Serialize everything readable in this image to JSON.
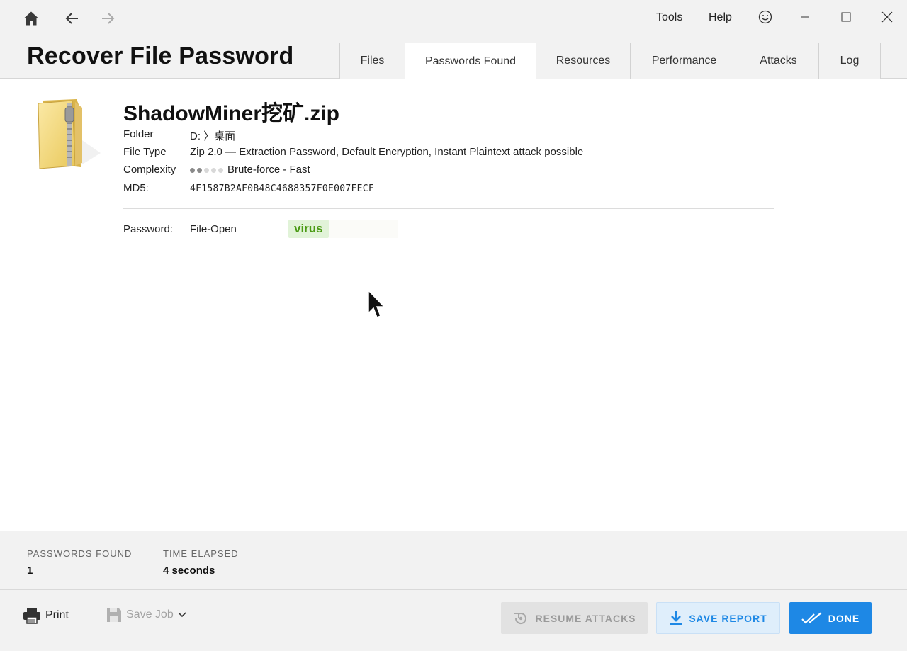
{
  "window": {
    "menu": {
      "tools": "Tools",
      "help": "Help"
    },
    "icons": {
      "home": "home-icon",
      "back": "arrow-left-icon",
      "forward": "arrow-right-icon",
      "feedback": "smiley-icon",
      "minimize": "minimize-icon",
      "maximize": "maximize-icon",
      "close": "close-icon"
    }
  },
  "app": {
    "title": "Recover File Password"
  },
  "tabs": [
    {
      "label": "Files",
      "active": false
    },
    {
      "label": "Passwords Found",
      "active": true
    },
    {
      "label": "Resources",
      "active": false
    },
    {
      "label": "Performance",
      "active": false
    },
    {
      "label": "Attacks",
      "active": false
    },
    {
      "label": "Log",
      "active": false
    }
  ],
  "file": {
    "name": "ShadowMiner挖矿.zip",
    "icon": "zip-folder-icon",
    "fields": {
      "folder_label": "Folder",
      "folder_value": "D: 〉桌面",
      "type_label": "File Type",
      "type_value": "Zip 2.0 — Extraction Password, Default Encryption, Instant Plaintext attack possible",
      "complexity_label": "Complexity",
      "complexity_value": "Brute-force - Fast",
      "complexity_level": 2,
      "complexity_max": 5,
      "md5_label": "MD5:",
      "md5_value": "4F1587B2AF0B48C4688357F0E007FECF"
    },
    "password": {
      "label": "Password:",
      "kind": "File-Open",
      "value": "virus"
    }
  },
  "stats": {
    "found_label": "PASSWORDS FOUND",
    "found_value": "1",
    "elapsed_label": "TIME ELAPSED",
    "elapsed_value": "4 seconds"
  },
  "footer": {
    "print": "Print",
    "save_job": "Save Job",
    "resume": "RESUME ATTACKS",
    "save_report": "SAVE REPORT",
    "done": "DONE"
  },
  "colors": {
    "accent": "#1e88e5",
    "password_bg": "#e1f3d8",
    "password_fg": "#4a9a14",
    "disabled_bg": "#e2e2e2"
  }
}
